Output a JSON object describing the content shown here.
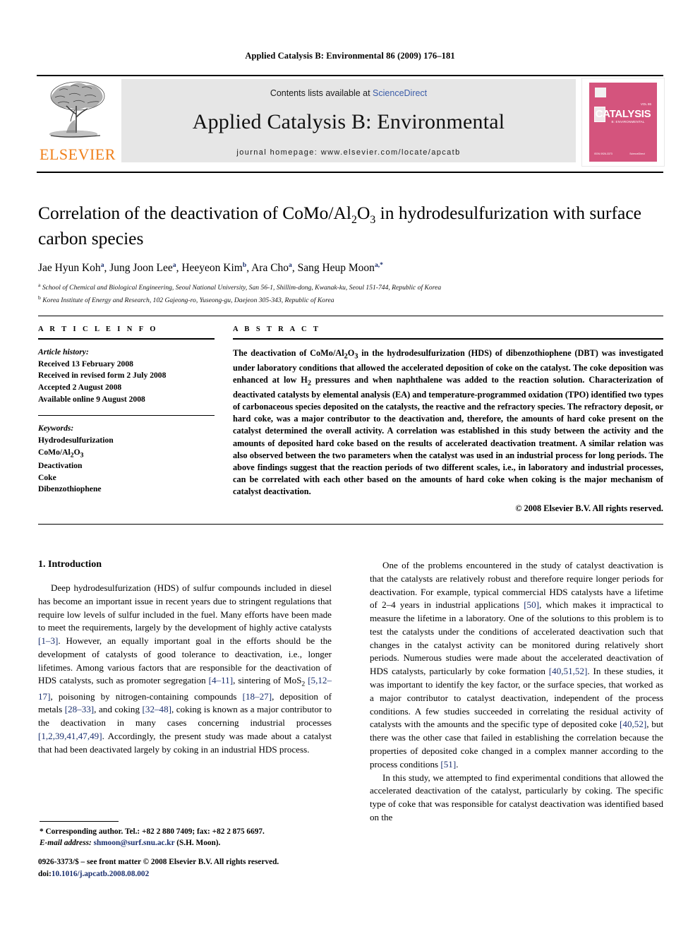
{
  "running_head": "Applied Catalysis B: Environmental 86 (2009) 176–181",
  "header": {
    "publisher": "ELSEVIER",
    "contents_prefix": "Contents lists available at ",
    "contents_link": "ScienceDirect",
    "journal_name": "Applied Catalysis B: Environmental",
    "homepage": "journal homepage: www.elsevier.com/locate/apcatb",
    "cover": {
      "title": "CATALYSIS",
      "subtitle": "B: ENVIRONMENTAL",
      "volume_label": "VOL 86",
      "bottom_left": "ISSN 0926-3373",
      "bottom_right": "ScienceDirect",
      "color": "#d4547d"
    }
  },
  "title_html": "Correlation of the deactivation of CoMo/Al<sub>2</sub>O<sub>3</sub> in hydrodesulfurization with surface carbon species",
  "authors_html": "Jae Hyun Koh<sup>a</sup>, Jung Joon Lee<sup>a</sup>, Heeyeon Kim<sup>b</sup>, Ara Cho<sup>a</sup>, Sang Heup Moon<sup>a,*</sup>",
  "affiliations": [
    "a School of Chemical and Biological Engineering, Seoul National University, San 56-1, Shillim-dong, Kwanak-ku, Seoul 151-744, Republic of Korea",
    "b Korea Institute of Energy and Research, 102 Gajeong-ro, Yuseong-gu, Daejeon 305-343, Republic of Korea"
  ],
  "article_info": {
    "label": "A R T I C L E   I N F O",
    "history_heading": "Article history:",
    "history": [
      "Received 13 February 2008",
      "Received in revised form 2 July 2008",
      "Accepted 2 August 2008",
      "Available online 9 August 2008"
    ],
    "keywords_heading": "Keywords:",
    "keywords_html": [
      "Hydrodesulfurization",
      "CoMo/Al<sub>2</sub>O<sub>3</sub>",
      "Deactivation",
      "Coke",
      "Dibenzothiophene"
    ]
  },
  "abstract": {
    "label": "A B S T R A C T",
    "text_html": "The deactivation of CoMo/Al<sub>2</sub>O<sub>3</sub> in the hydrodesulfurization (HDS) of dibenzothiophene (DBT) was investigated under laboratory conditions that allowed the accelerated deposition of coke on the catalyst. The coke deposition was enhanced at low H<sub>2</sub> pressures and when naphthalene was added to the reaction solution. Characterization of deactivated catalysts by elemental analysis (EA) and temperature-programmed oxidation (TPO) identified two types of carbonaceous species deposited on the catalysts, the reactive and the refractory species. The refractory deposit, or hard coke, was a major contributor to the deactivation and, therefore, the amounts of hard coke present on the catalyst determined the overall activity. A correlation was established in this study between the activity and the amounts of deposited hard coke based on the results of accelerated deactivation treatment. A similar relation was also observed between the two parameters when the catalyst was used in an industrial process for long periods. The above findings suggest that the reaction periods of two different scales, i.e., in laboratory and industrial processes, can be correlated with each other based on the amounts of hard coke when coking is the major mechanism of catalyst deactivation.",
    "copyright": "© 2008 Elsevier B.V. All rights reserved."
  },
  "body": {
    "section_heading": "1. Introduction",
    "left_paragraphs_html": [
      "Deep hydrodesulfurization (HDS) of sulfur compounds included in diesel has become an important issue in recent years due to stringent regulations that require low levels of sulfur included in the fuel. Many efforts have been made to meet the requirements, largely by the development of highly active catalysts <span class=\"ref\">[1–3]</span>. However, an equally important goal in the efforts should be the development of catalysts of good tolerance to deactivation, i.e., longer lifetimes. Among various factors that are responsible for the deactivation of HDS catalysts, such as promoter segregation <span class=\"ref\">[4–11]</span>, sintering of MoS<sub>2</sub> <span class=\"ref\">[5,12–17]</span>, poisoning by nitrogen-containing compounds <span class=\"ref\">[18–27]</span>, deposition of metals <span class=\"ref\">[28–33]</span>, and coking <span class=\"ref\">[32–48]</span>, coking is known as a major contributor to the deactivation in many cases concerning industrial processes <span class=\"ref\">[1,2,39,41,47,49]</span>. Accordingly, the present study was made about a catalyst that had been deactivated largely by coking in an industrial HDS process."
    ],
    "right_paragraphs_html": [
      "One of the problems encountered in the study of catalyst deactivation is that the catalysts are relatively robust and therefore require longer periods for deactivation. For example, typical commercial HDS catalysts have a lifetime of 2–4 years in industrial applications <span class=\"ref\">[50]</span>, which makes it impractical to measure the lifetime in a laboratory. One of the solutions to this problem is to test the catalysts under the conditions of accelerated deactivation such that changes in the catalyst activity can be monitored during relatively short periods. Numerous studies were made about the accelerated deactivation of HDS catalysts, particularly by coke formation <span class=\"ref\">[40,51,52]</span>. In these studies, it was important to identify the key factor, or the surface species, that worked as a major contributor to catalyst deactivation, independent of the process conditions. A few studies succeeded in correlating the residual activity of catalysts with the amounts and the specific type of deposited coke <span class=\"ref\">[40,52]</span>, but there was the other case that failed in establishing the correlation because the properties of deposited coke changed in a complex manner according to the process conditions <span class=\"ref\">[51]</span>.",
      "In this study, we attempted to find experimental conditions that allowed the accelerated deactivation of the catalyst, particularly by coking. The specific type of coke that was responsible for catalyst deactivation was identified based on the"
    ]
  },
  "footnote": {
    "corresponding_html": "* Corresponding author. Tel.: +82 2 880 7409; fax: +82 2 875 6697.",
    "email_label": "E-mail address:",
    "email": "shmoon@surf.snu.ac.kr",
    "email_suffix": "(S.H. Moon)."
  },
  "imprint": {
    "line1": "0926-3373/$ – see front matter © 2008 Elsevier B.V. All rights reserved.",
    "doi_label": "doi:",
    "doi_value": "10.1016/j.apcatb.2008.08.002"
  }
}
